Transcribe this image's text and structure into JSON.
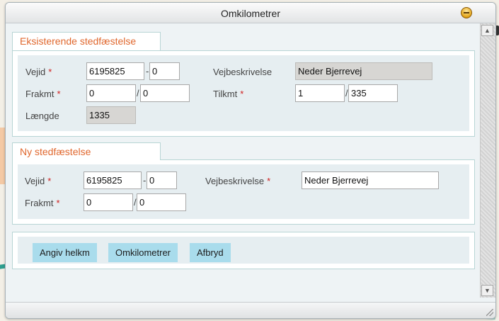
{
  "window": {
    "title": "Omkilometrer"
  },
  "existing": {
    "legend": "Eksisterende stedfæstelse",
    "vejid_label": "Vejid",
    "vejid_value": "6195825",
    "vejid_sub_value": "0",
    "vejbeskrivelse_label": "Vejbeskrivelse",
    "vejbeskrivelse_value": "Neder Bjerrevej",
    "frakmt_label": "Frakmt",
    "frakmt_value": "0",
    "frakmt_sub_value": "0",
    "tilkmt_label": "Tilkmt",
    "tilkmt_value": "1",
    "tilkmt_sub_value": "335",
    "laengde_label": "Længde",
    "laengde_value": "1335"
  },
  "new": {
    "legend": "Ny stedfæstelse",
    "vejid_label": "Vejid",
    "vejid_value": "6195825",
    "vejid_sub_value": "0",
    "vejbeskrivelse_label": "Vejbeskrivelse",
    "vejbeskrivelse_value": "Neder Bjerrevej",
    "frakmt_label": "Frakmt",
    "frakmt_value": "0",
    "frakmt_sub_value": "0"
  },
  "symbols": {
    "required": "*",
    "dash": "-",
    "slash": "/"
  },
  "buttons": {
    "angiv_helkm": "Angiv helkm",
    "omkilometrer": "Omkilometrer",
    "afbryd": "Afbryd"
  }
}
